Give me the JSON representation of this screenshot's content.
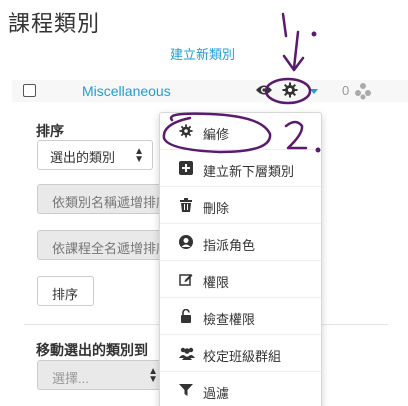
{
  "header": {
    "title": "課程類別",
    "add_link": "建立新類別"
  },
  "category_row": {
    "name": "Miscellaneous",
    "count": "0",
    "icons": [
      "checkbox-icon",
      "eye-icon",
      "gear-icon",
      "caret-down-icon",
      "cohort-icon"
    ]
  },
  "sort_panel": {
    "label": "排序",
    "select_value": "選出的類別",
    "btn_sort_by_name": "依類別名稱遞增排序",
    "btn_sort_by_fullname": "依課程全名遞增排序",
    "btn_sort": "排序"
  },
  "move_panel": {
    "label": "移動選出的類別到",
    "select_placeholder": "選擇..."
  },
  "action_menu": {
    "items": [
      {
        "label": "編修",
        "icon": "gear-icon"
      },
      {
        "label": "建立新下層類別",
        "icon": "plus-square-icon"
      },
      {
        "label": "刪除",
        "icon": "trash-icon"
      },
      {
        "label": "指派角色",
        "icon": "user-icon"
      },
      {
        "label": "權限",
        "icon": "edit-icon"
      },
      {
        "label": "檢查權限",
        "icon": "unlock-icon"
      },
      {
        "label": "校定班級群組",
        "icon": "users-icon"
      },
      {
        "label": "過濾",
        "icon": "filter-icon"
      }
    ]
  },
  "annotations": {
    "mark_1": "1",
    "mark_2": "2",
    "ink_color": "#5a1a6e"
  },
  "colors": {
    "link": "#1f9ed1",
    "text": "#333333",
    "disabled_bg": "#e9e9e9"
  }
}
